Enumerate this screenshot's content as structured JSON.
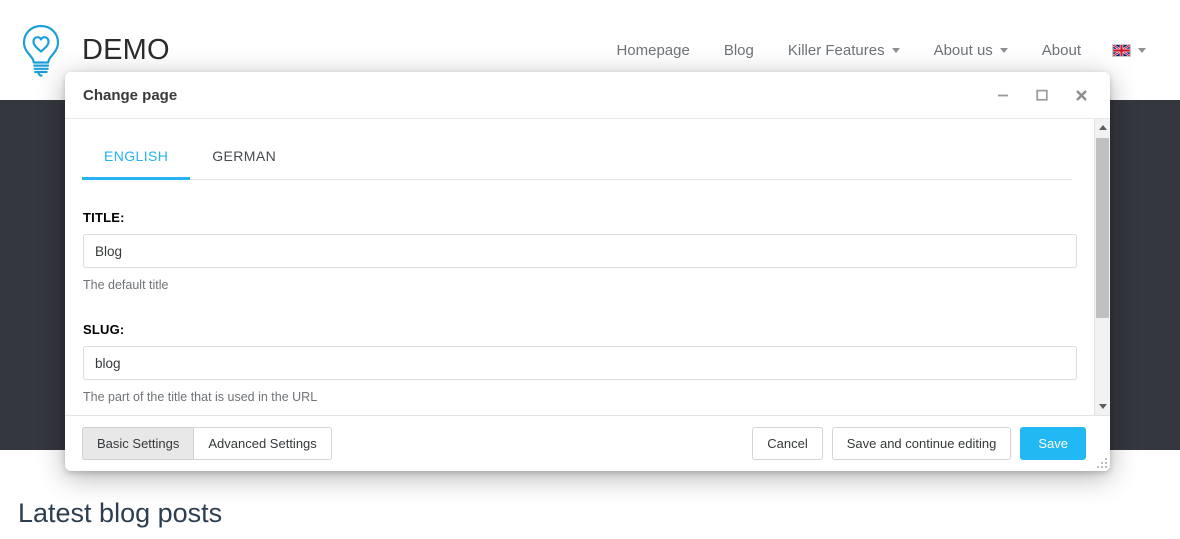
{
  "site": {
    "brand_name": "DEMO",
    "logo_icon": "lightbulb-heart-icon",
    "nav": [
      {
        "label": "Homepage",
        "has_dropdown": false
      },
      {
        "label": "Blog",
        "has_dropdown": false
      },
      {
        "label": "Killer Features",
        "has_dropdown": true
      },
      {
        "label": "About us",
        "has_dropdown": true
      },
      {
        "label": "About",
        "has_dropdown": false
      }
    ],
    "language_selector": {
      "flag": "uk-flag-icon",
      "has_dropdown": true
    },
    "section_heading": "Latest blog posts"
  },
  "modal": {
    "title": "Change page",
    "window_controls": {
      "minimize": "minimize-icon",
      "maximize": "maximize-icon",
      "close": "close-icon"
    },
    "tabs": [
      {
        "label": "ENGLISH",
        "active": true
      },
      {
        "label": "GERMAN",
        "active": false
      }
    ],
    "fields": [
      {
        "label": "TITLE:",
        "value": "Blog",
        "placeholder": "",
        "help": "The default title"
      },
      {
        "label": "SLUG:",
        "value": "blog",
        "placeholder": "",
        "help": "The part of the title that is used in the URL"
      }
    ],
    "footer": {
      "settings_tabs": [
        {
          "label": "Basic Settings",
          "active": true
        },
        {
          "label": "Advanced Settings",
          "active": false
        }
      ],
      "cancel_label": "Cancel",
      "save_continue_label": "Save and continue editing",
      "save_label": "Save"
    }
  },
  "colors": {
    "accent": "#22b8f3",
    "dark_band": "#34373d",
    "heading": "#2c3e50",
    "logo": "#1f9fd8"
  }
}
